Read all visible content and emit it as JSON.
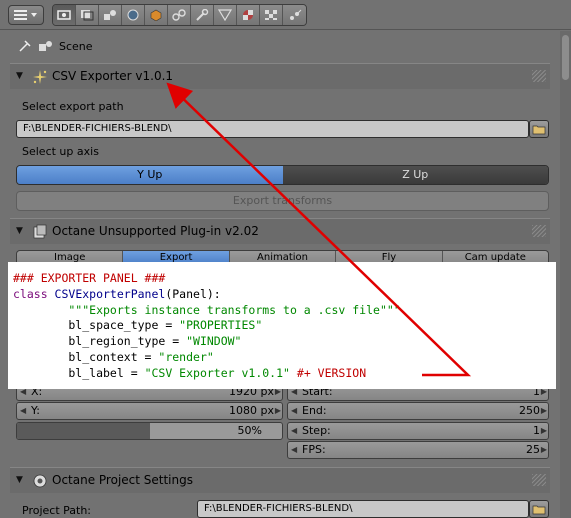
{
  "toolbar": {
    "context_icons": [
      "render-icon",
      "render-layers-icon",
      "scene-icon",
      "world-icon",
      "object-icon",
      "constraints-icon",
      "modifiers-icon",
      "data-icon",
      "material-icon",
      "texture-icon",
      "particles-icon"
    ],
    "active_context": "render-icon"
  },
  "breadcrumb": {
    "scene": "Scene"
  },
  "csv_panel": {
    "title": "CSV Exporter v1.0.1",
    "path_label": "Select export path",
    "path_value": "F:\\BLENDER-FICHIERS-BLEND\\",
    "axis_label": "Select up axis",
    "axis_options": [
      "Y Up",
      "Z Up"
    ],
    "axis_selected": "Y Up",
    "export_button": "Export transforms"
  },
  "octane_panel": {
    "title": "Octane Unsupported Plug-in v2.02",
    "tabs": [
      "Image",
      "Export",
      "Animation",
      "Fly",
      "Cam update"
    ],
    "selected_tab": "Export",
    "fields": {
      "x_label": "X:",
      "x_value": "1920 px",
      "y_label": "Y:",
      "y_value": "1080 px",
      "percent": "50%",
      "start_label": "Start:",
      "start_value": "1",
      "end_label": "End:",
      "end_value": "250",
      "step_label": "Step:",
      "step_value": "1",
      "fps_label": "FPS:",
      "fps_value": "25"
    }
  },
  "project_panel": {
    "title": "Octane Project Settings",
    "path_label": "Project Path:",
    "path_value": "F:\\BLENDER-FICHIERS-BLEND\\"
  },
  "code_overlay": {
    "lines": {
      "l1": "### EXPORTER PANEL ###",
      "l2_kw": "class ",
      "l2_name": "CSVExporterPanel",
      "l2_rest": "(Panel):",
      "l3": "        \"\"\"Exports instance transforms to a .csv file\"\"\"",
      "l4_key": "        bl_space_type = ",
      "l4_val": "\"PROPERTIES\"",
      "l5_key": "        bl_region_type = ",
      "l5_val": "\"WINDOW\"",
      "l6_key": "        bl_context = ",
      "l6_val": "\"render\"",
      "l7_key": "        bl_label = ",
      "l7_val": "\"CSV Exporter v1.0.1\"",
      "l7_comment": " #+ VERSION"
    }
  },
  "colors": {
    "accent_blue": "#5a8ad4",
    "arrow_red": "#e00000",
    "panel_bg": "#727272"
  }
}
